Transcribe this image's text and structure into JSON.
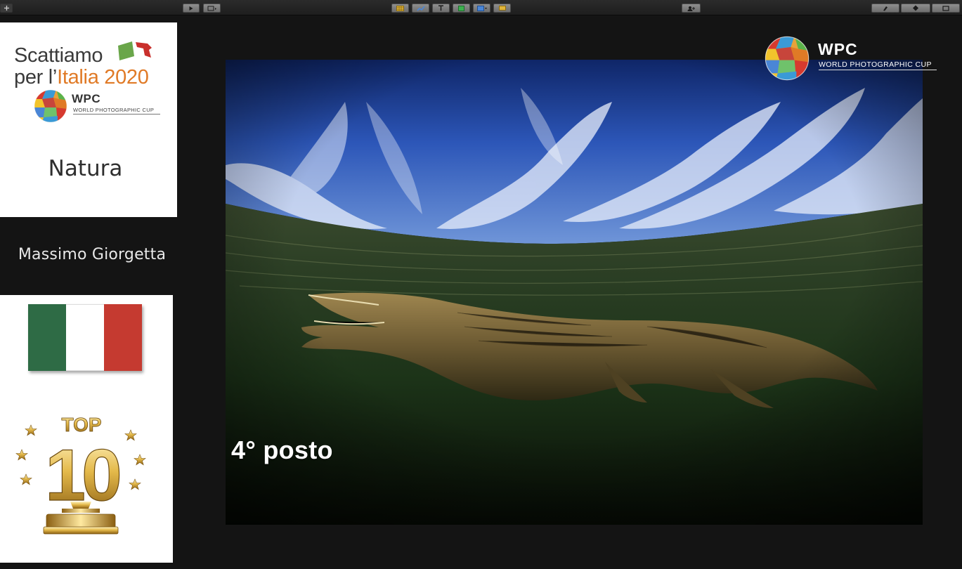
{
  "toolbar": {
    "buttons": [
      {
        "id": "add",
        "icon": "plus-icon"
      },
      {
        "id": "play",
        "icon": "play-icon"
      },
      {
        "id": "slide-view",
        "icon": "slide-view-icon"
      },
      {
        "id": "table",
        "icon": "table-icon",
        "color": "#e0b53a"
      },
      {
        "id": "chart",
        "icon": "chart-icon",
        "color": "#4a86d6"
      },
      {
        "id": "text",
        "icon": "text-icon"
      },
      {
        "id": "shape",
        "icon": "shape-icon",
        "color": "#3db04f"
      },
      {
        "id": "media",
        "icon": "media-icon",
        "color": "#4a86d6"
      },
      {
        "id": "comment",
        "icon": "comment-icon",
        "color": "#e0b53a"
      },
      {
        "id": "collaborate",
        "icon": "collaborate-icon"
      },
      {
        "id": "format",
        "icon": "format-brush-icon"
      },
      {
        "id": "animate",
        "icon": "animate-icon"
      },
      {
        "id": "document",
        "icon": "document-icon"
      }
    ]
  },
  "sidebar": {
    "brand": {
      "line1": "Scattiamo",
      "line2_a": "per l’",
      "line2_b": "Italia 2020",
      "accent": "#e07a26"
    },
    "wpc_logo": {
      "title": "WPC",
      "subtitle": "WORLD PHOTOGRAPHIC CUP"
    },
    "category": "Natura",
    "author": "Massimo Giorgetta",
    "flag": {
      "colors": [
        "#2e6b45",
        "#ffffff",
        "#c53a30"
      ]
    },
    "badge": {
      "top_text": "TOP",
      "number": "10"
    }
  },
  "slide": {
    "rank_label": "4° posto",
    "wpc_logo": {
      "title": "WPC",
      "subtitle": "WORLD PHOTOGRAPHIC CUP"
    }
  }
}
